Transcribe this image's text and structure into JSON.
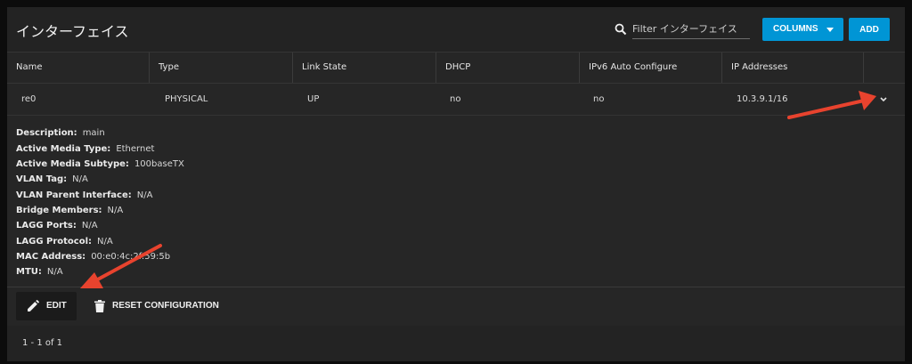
{
  "page": {
    "title": "インターフェイス"
  },
  "toolbar": {
    "filter_placeholder": "Filter インターフェイス",
    "columns_label": "COLUMNS",
    "add_label": "ADD"
  },
  "table": {
    "columns": [
      "Name",
      "Type",
      "Link State",
      "DHCP",
      "IPv6 Auto Configure",
      "IP Addresses"
    ],
    "rows": [
      {
        "name": "re0",
        "type": "PHYSICAL",
        "link_state": "UP",
        "dhcp": "no",
        "ipv6_auto": "no",
        "ip": "10.3.9.1/16"
      }
    ]
  },
  "details": [
    {
      "label": "Description:",
      "value": "main"
    },
    {
      "label": "Active Media Type:",
      "value": "Ethernet"
    },
    {
      "label": "Active Media Subtype:",
      "value": "100baseTX"
    },
    {
      "label": "VLAN Tag:",
      "value": "N/A"
    },
    {
      "label": "VLAN Parent Interface:",
      "value": "N/A"
    },
    {
      "label": "Bridge Members:",
      "value": "N/A"
    },
    {
      "label": "LAGG Ports:",
      "value": "N/A"
    },
    {
      "label": "LAGG Protocol:",
      "value": "N/A"
    },
    {
      "label": "MAC Address:",
      "value": "00:e0:4c:2f:59:5b"
    },
    {
      "label": "MTU:",
      "value": "N/A"
    }
  ],
  "actions": {
    "edit_label": "EDIT",
    "reset_label": "RESET CONFIGURATION"
  },
  "footer": {
    "paging": "1 - 1 of 1"
  },
  "colors": {
    "accent": "#0095d5",
    "annotation_arrow": "#e8432e",
    "panel": "#232323"
  },
  "icons": [
    "search-icon",
    "dropdown-caret-icon",
    "chevron-down-icon",
    "pencil-icon",
    "trash-icon"
  ]
}
